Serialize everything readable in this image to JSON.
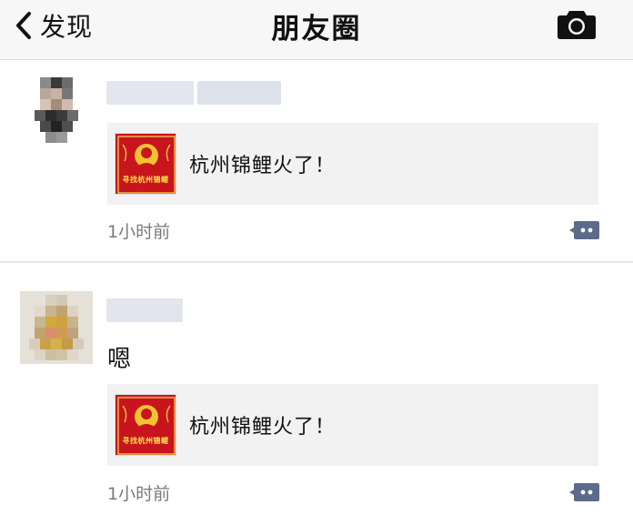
{
  "navbar": {
    "back_label": "发现",
    "title": "朋友圈",
    "camera_icon": "camera-icon"
  },
  "colors": {
    "accent": "#5b6b8c",
    "nav_bg": "#f7f7f7",
    "card_bg": "#f2f2f2",
    "thumb_red": "#c8141c",
    "thumb_yellow": "#ffe34d",
    "timestamp": "#7a7a7a"
  },
  "posts": [
    {
      "text": "",
      "link": {
        "title": "杭州锦鲤火了！",
        "thumb_text": "寻找杭州锦鲤"
      },
      "time": "1小时前",
      "comment_icon": "comment-bubble-icon"
    },
    {
      "text": "嗯",
      "link": {
        "title": "杭州锦鲤火了！",
        "thumb_text": "寻找杭州锦鲤"
      },
      "time": "1小时前",
      "comment_icon": "comment-bubble-icon"
    }
  ]
}
